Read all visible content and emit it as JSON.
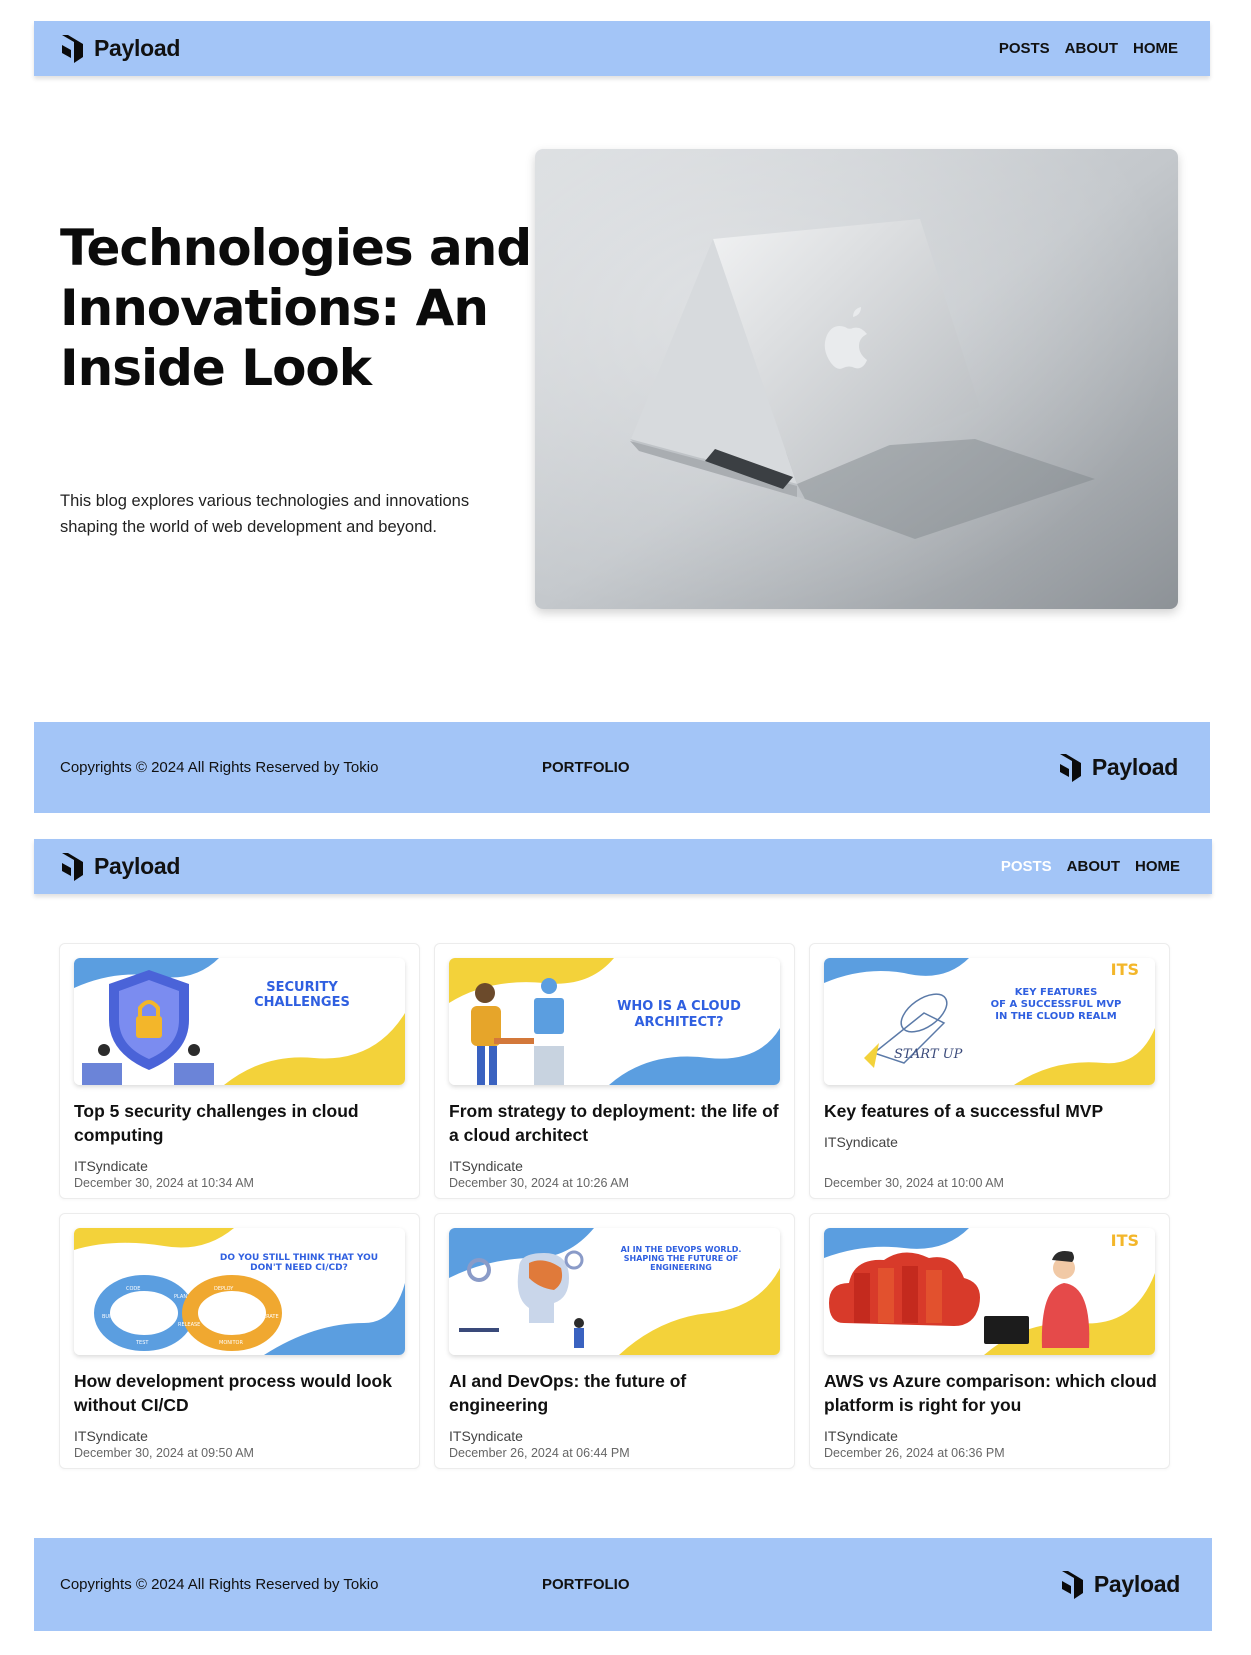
{
  "top_page": {
    "navbar": {
      "logo_text": "Payload",
      "links": [
        "POSTS",
        "ABOUT",
        "HOME"
      ]
    },
    "hero": {
      "title": "Technologies and Innovations: An Inside Look",
      "description": "This blog explores various technologies and innovations shaping the world of web development and beyond."
    },
    "footer": {
      "copyright": "Copyrights © 2024 All Rights Reserved by Tokio",
      "portfolio": "PORTFOLIO",
      "logo_text": "Payload"
    }
  },
  "posts_page": {
    "navbar": {
      "logo_text": "Payload",
      "links": [
        "POSTS",
        "ABOUT",
        "HOME"
      ],
      "active": "POSTS"
    },
    "posts": [
      {
        "title": "Top 5 security challenges in cloud computing",
        "author": "ITSyndicate",
        "date": "December 30, 2024 at 10:34 AM",
        "thumb_text": [
          "SECURITY",
          "CHALLENGES"
        ]
      },
      {
        "title": "From strategy to deployment: the life of a cloud architect",
        "author": "ITSyndicate",
        "date": "December 30, 2024 at 10:26 AM",
        "thumb_text": [
          "WHO IS A CLOUD",
          "ARCHITECT?"
        ]
      },
      {
        "title": "Key features of a successful MVP",
        "author": "ITSyndicate",
        "date": "December 30, 2024 at 10:00 AM",
        "thumb_text": [
          "KEY FEATURES",
          "OF A SUCCESSFUL MVP",
          "IN THE CLOUD REALM"
        ],
        "thumb_brand": "ITS",
        "thumb_sketch": "START UP"
      },
      {
        "title": "How development process would look without CI/CD",
        "author": "ITSyndicate",
        "date": "December 30, 2024 at 09:50 AM",
        "thumb_text": [
          "DO YOU STILL THINK THAT YOU",
          "DON'T NEED CI/CD?"
        ],
        "thumb_labels": [
          "CODE",
          "BUILD",
          "TEST",
          "PLAN",
          "RELEASE",
          "DEPLOY",
          "OPERATE",
          "MONITOR"
        ]
      },
      {
        "title": "AI and DevOps: the future of engineering",
        "author": "ITSyndicate",
        "date": "December 26, 2024 at 06:44 PM",
        "thumb_text": [
          "AI IN THE DEVOPS WORLD.",
          "SHAPING THE FUTURE OF",
          "ENGINEERING"
        ]
      },
      {
        "title": "AWS vs Azure comparison: which cloud platform is right for you",
        "author": "ITSyndicate",
        "date": "December 26, 2024 at 06:36 PM",
        "thumb_brand": "ITS"
      }
    ],
    "footer": {
      "copyright": "Copyrights © 2024 All Rights Reserved by Tokio",
      "portfolio": "PORTFOLIO",
      "logo_text": "Payload"
    }
  },
  "colors": {
    "bar": "#a3c5f7",
    "thumb_yellow": "#f3d23a",
    "thumb_blue": "#5b9ee0",
    "thumb_text": "#2f5fe0"
  }
}
